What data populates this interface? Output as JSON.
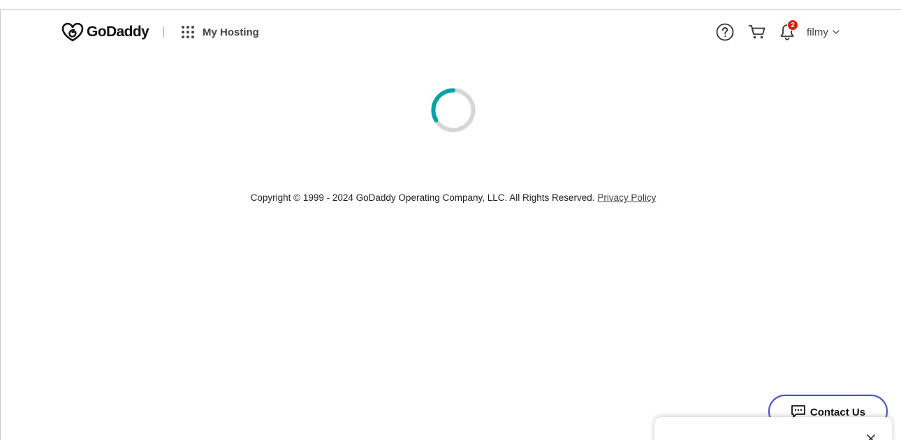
{
  "header": {
    "logo_text": "GoDaddy",
    "product_label": "My Hosting",
    "icons": {
      "apps": "apps-grid-icon",
      "help": "help-icon",
      "cart": "cart-icon",
      "notifications": "bell-icon"
    },
    "notification_count": "2",
    "username": "filmy"
  },
  "main": {
    "loading": true,
    "spinner_color": "#00a4a6"
  },
  "footer": {
    "copyright": "Copyright © 1999 - 2024 GoDaddy Operating Company, LLC. All Rights Reserved.",
    "privacy_link": "Privacy Policy"
  },
  "contact_button": {
    "label": "Contact Us",
    "icon": "chat-icon"
  },
  "colors": {
    "brand_text": "#111111",
    "badge": "#d41e0f",
    "contact_border": "#4a54c8",
    "spinner_accent": "#00a4a6"
  }
}
